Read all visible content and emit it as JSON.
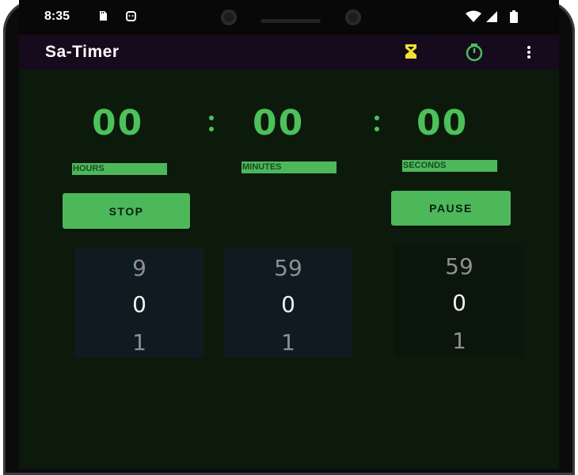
{
  "status_bar": {
    "time": "8:35",
    "icons": [
      "sd-card-icon",
      "android-debug-icon",
      "wifi-icon",
      "signal-icon",
      "battery-icon"
    ]
  },
  "app_bar": {
    "title": "Sa-Timer",
    "actions": [
      {
        "name": "hourglass-icon",
        "color": "#f0e230"
      },
      {
        "name": "stopwatch-icon",
        "color": "#4cc15a"
      },
      {
        "name": "more-vert-icon",
        "color": "#ffffff"
      }
    ]
  },
  "display": {
    "hours": "00",
    "minutes": "00",
    "seconds": "00"
  },
  "labels": {
    "hours": "HOURS",
    "minutes": "MINUTES",
    "seconds": "SECONDS"
  },
  "buttons": {
    "stop": "STOP",
    "pause": "PAUSE"
  },
  "pickers": {
    "hours": {
      "prev": "9",
      "current": "0",
      "next": "1"
    },
    "minutes": {
      "prev": "59",
      "current": "0",
      "next": "1"
    },
    "seconds": {
      "prev": "59",
      "current": "0",
      "next": "1"
    }
  },
  "colors": {
    "accent_green": "#4cc15a",
    "background": "#0c1a0c",
    "app_bar": "#160b1d",
    "hourglass": "#f0e230"
  }
}
